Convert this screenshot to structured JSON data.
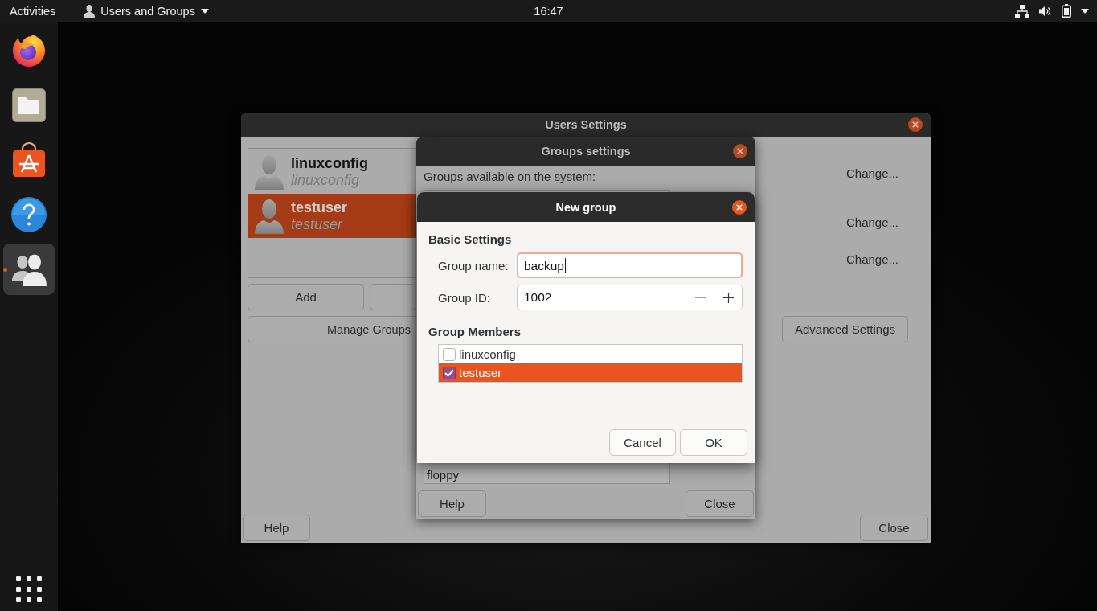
{
  "top_bar": {
    "activities": "Activities",
    "app_menu": "Users and Groups",
    "clock": "16:47"
  },
  "dock": {
    "apps": [
      {
        "kind": "browser",
        "selected": false,
        "running": false
      },
      {
        "kind": "files",
        "selected": false,
        "running": false
      },
      {
        "kind": "software",
        "selected": false,
        "running": false
      },
      {
        "kind": "help",
        "selected": false,
        "running": false
      },
      {
        "kind": "users",
        "selected": true,
        "running": true
      }
    ]
  },
  "users_settings": {
    "title": "Users Settings",
    "focused": false,
    "users": [
      {
        "name": "linuxconfig",
        "login": "linuxconfig",
        "selected": false
      },
      {
        "name": "testuser",
        "login": "testuser",
        "selected": true
      }
    ],
    "add_button": "Add",
    "manage_groups_button": "Manage Groups",
    "change_buttons": [
      "Change...",
      "Change...",
      "Change..."
    ],
    "advanced_button": "Advanced Settings",
    "help_button": "Help",
    "close_button": "Close"
  },
  "groups_settings": {
    "title": "Groups settings",
    "focused": false,
    "list_label": "Groups available on the system:",
    "groups": [
      "floppy"
    ],
    "help_button": "Help",
    "close_button": "Close"
  },
  "new_group": {
    "title": "New group",
    "focused": true,
    "basic_heading": "Basic Settings",
    "name_label": "Group name:",
    "name_value": "backup",
    "id_label": "Group ID:",
    "id_value": "1002",
    "members_heading": "Group Members",
    "members": [
      {
        "name": "linuxconfig",
        "checked": false,
        "selected": false
      },
      {
        "name": "testuser",
        "checked": true,
        "selected": true
      }
    ],
    "cancel_button": "Cancel",
    "ok_button": "OK"
  }
}
